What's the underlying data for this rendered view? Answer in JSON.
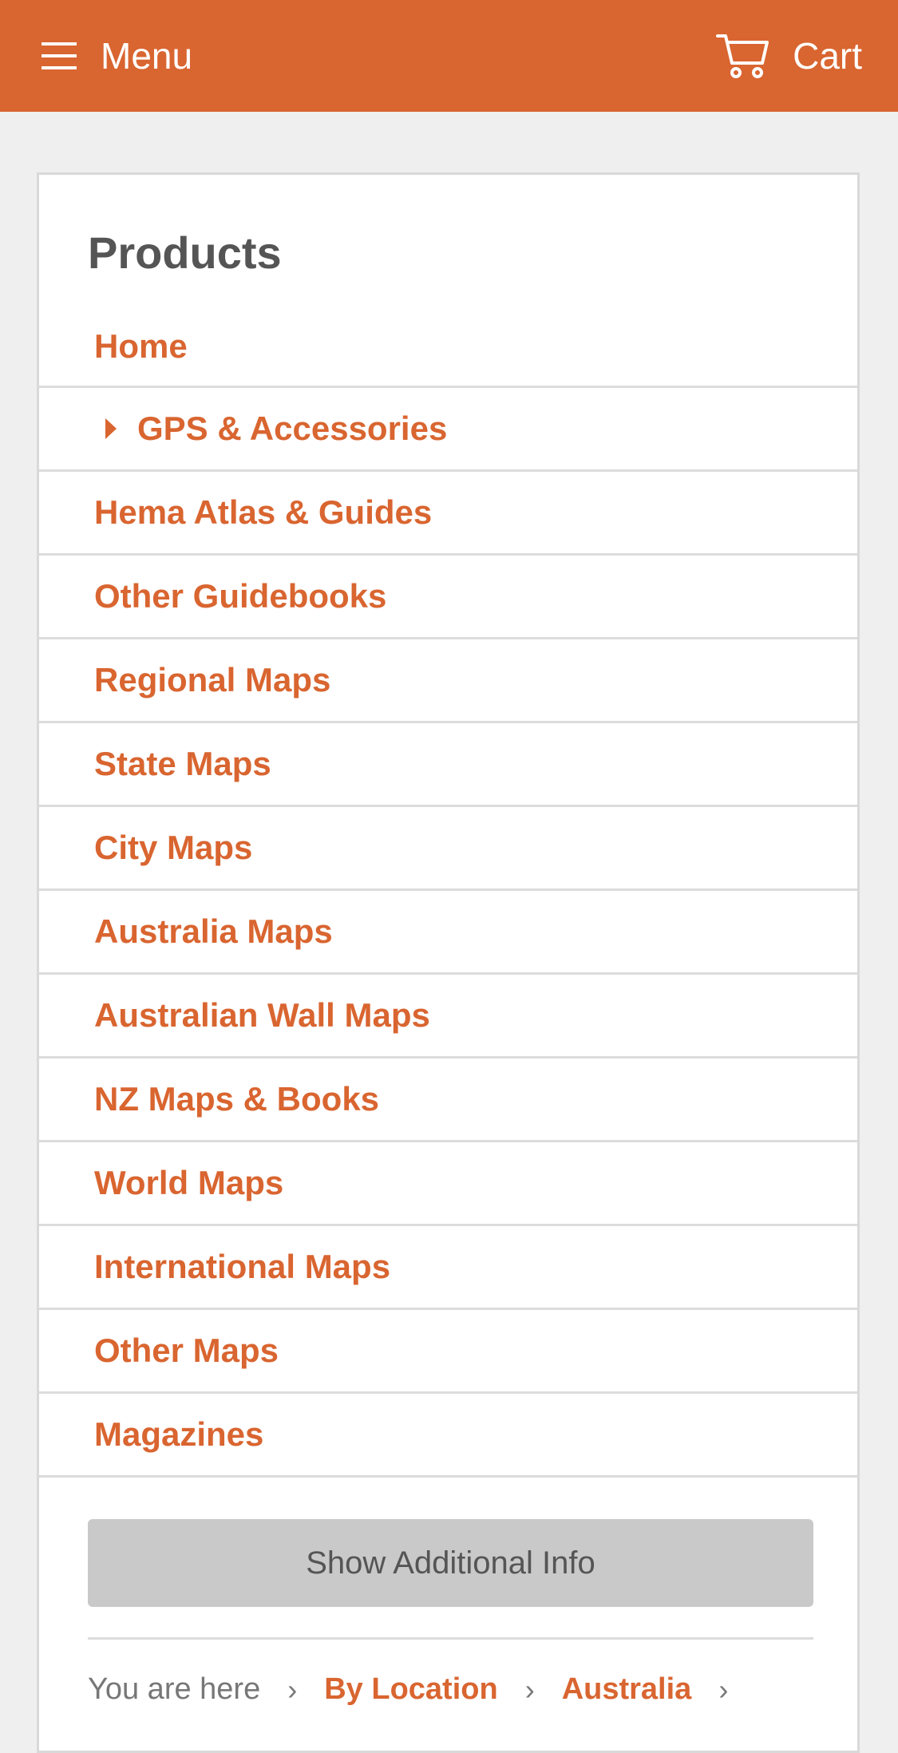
{
  "header": {
    "menu_label": "Menu",
    "cart_label": "Cart"
  },
  "sidebar": {
    "title": "Products",
    "items": [
      {
        "label": "Home"
      },
      {
        "label": "GPS & Accessories",
        "expandable": true
      },
      {
        "label": "Hema Atlas & Guides"
      },
      {
        "label": "Other Guidebooks"
      },
      {
        "label": "Regional Maps"
      },
      {
        "label": "State Maps"
      },
      {
        "label": "City Maps"
      },
      {
        "label": "Australia Maps"
      },
      {
        "label": "Australian Wall Maps"
      },
      {
        "label": "NZ Maps & Books"
      },
      {
        "label": "World Maps"
      },
      {
        "label": "International Maps"
      },
      {
        "label": "Other Maps"
      },
      {
        "label": "Magazines"
      }
    ],
    "show_info_label": "Show Additional Info"
  },
  "breadcrumb": {
    "prefix": "You are here",
    "separator": "›",
    "links": [
      "By Location",
      "Australia"
    ]
  },
  "colors": {
    "accent": "#d96530",
    "background": "#efefef",
    "button_gray": "#c9c9c9",
    "text_gray": "#555555"
  },
  "icons": {
    "menu": "hamburger-icon",
    "cart": "cart-icon",
    "expand": "caret-right-icon"
  }
}
